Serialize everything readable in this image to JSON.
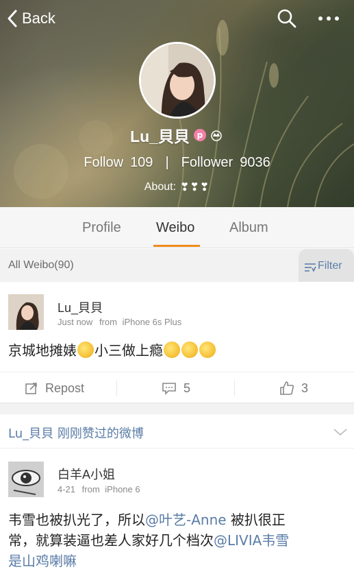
{
  "header": {
    "back_label": "Back",
    "username": "Lu_貝貝",
    "badge_letter": "p",
    "follow_label": "Follow",
    "follow_count": "109",
    "separator": "|",
    "follower_label": "Follower",
    "follower_count": "9036",
    "about_label": "About:",
    "about_value": "❣❣❣"
  },
  "tabs": [
    {
      "label": "Profile",
      "active": false
    },
    {
      "label": "Weibo",
      "active": true
    },
    {
      "label": "Album",
      "active": false
    }
  ],
  "filter_bar": {
    "all_label": "All Weibo(90)",
    "filter_label": "Filter"
  },
  "post1": {
    "author": "Lu_貝貝",
    "time": "Just now",
    "from_label": "from",
    "source": "iPhone 6s Plus",
    "text_a": "京城地摊婊",
    "text_b": "小三做上瘾"
  },
  "actions": {
    "repost_label": "Repost",
    "comment_count": "5",
    "like_count": "3"
  },
  "liked_bar": {
    "text": "Lu_貝貝 刚刚赞过的微博"
  },
  "post2": {
    "author": "白羊A小姐",
    "time": "4-21",
    "from_label": "from",
    "source": "iPhone 6",
    "line1_a": "韦雪也被扒光了，所以",
    "mention1": "@叶艺-Anne",
    "line1_b": " 被扒很正",
    "line2_a": "常，就算装逼也差人家好几个档次",
    "mention2": "@LIVIA韦雪",
    "line3": "是山鸡喇嘛"
  },
  "colors": {
    "accent_orange": "#f08b1c",
    "link_blue": "#5a7ca7",
    "badge_pink": "#f27fa8"
  },
  "icons": [
    "chevron-left-icon",
    "search-icon",
    "more-icon",
    "crown-icon",
    "filter-icon",
    "chevron-down-icon",
    "repost-icon",
    "comment-icon",
    "like-icon"
  ]
}
